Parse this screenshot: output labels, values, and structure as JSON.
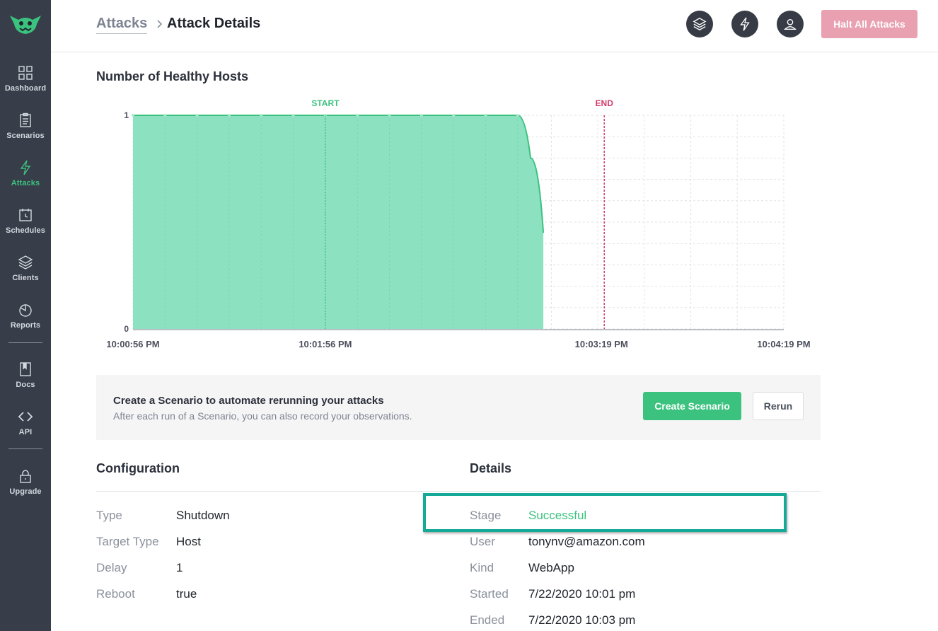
{
  "sidebar": {
    "items": [
      {
        "label": "Dashboard",
        "icon": "dashboard-icon"
      },
      {
        "label": "Scenarios",
        "icon": "clipboard-icon"
      },
      {
        "label": "Attacks",
        "icon": "lightning-icon",
        "active": true
      },
      {
        "label": "Schedules",
        "icon": "calendar-clock-icon"
      },
      {
        "label": "Clients",
        "icon": "layers-icon"
      },
      {
        "label": "Reports",
        "icon": "pie-chart-icon"
      },
      {
        "label": "Docs",
        "icon": "book-icon"
      },
      {
        "label": "API",
        "icon": "code-icon"
      },
      {
        "label": "Upgrade",
        "icon": "lock-icon"
      }
    ]
  },
  "header": {
    "breadcrumb_link": "Attacks",
    "breadcrumb_current": "Attack Details",
    "halt_label": "Halt All Attacks"
  },
  "chart": {
    "title": "Number of Healthy Hosts",
    "start_label": "START",
    "end_label": "END"
  },
  "chart_data": {
    "type": "area",
    "title": "Number of Healthy Hosts",
    "x_tick_labels": [
      "10:00:56 PM",
      "10:01:56 PM",
      "10:03:19 PM",
      "10:04:19 PM"
    ],
    "y_tick_labels": [
      "1",
      "0"
    ],
    "ylim": [
      0,
      1
    ],
    "x_range": [
      "10:00:56 PM",
      "10:04:19 PM"
    ],
    "series": [
      {
        "x": [
          "10:00:56 PM",
          "10:01:06 PM",
          "10:01:16 PM",
          "10:01:26 PM",
          "10:01:36 PM",
          "10:01:46 PM",
          "10:01:56 PM",
          "10:02:06 PM",
          "10:02:16 PM",
          "10:02:26 PM",
          "10:02:36 PM",
          "10:02:46 PM",
          "10:02:56 PM",
          "10:03:00 PM",
          "10:03:04 PM"
        ],
        "values": [
          1,
          1,
          1,
          1,
          1,
          1,
          1,
          1,
          1,
          1,
          1,
          1,
          1,
          0.8,
          0.45
        ]
      }
    ],
    "annotations": [
      {
        "label": "START",
        "x": "10:01:56 PM"
      },
      {
        "label": "END",
        "x": "10:03:23 PM"
      }
    ],
    "grid": true,
    "colors": {
      "fill": "#8ce1c0",
      "line": "#3cc27f",
      "start": "#3cc27f",
      "end": "#d33c6a"
    }
  },
  "banner": {
    "title": "Create a Scenario to automate rerunning your attacks",
    "subtitle": "After each run of a Scenario, you can also record your observations.",
    "create_label": "Create Scenario",
    "rerun_label": "Rerun"
  },
  "configuration": {
    "title": "Configuration",
    "rows": [
      {
        "key": "Type",
        "value": "Shutdown"
      },
      {
        "key": "Target Type",
        "value": "Host"
      },
      {
        "key": "Delay",
        "value": "1"
      },
      {
        "key": "Reboot",
        "value": "true"
      }
    ]
  },
  "details": {
    "title": "Details",
    "rows": [
      {
        "key": "Stage",
        "value": "Successful"
      },
      {
        "key": "User",
        "value": "tonynv@amazon.com"
      },
      {
        "key": "Kind",
        "value": "WebApp"
      },
      {
        "key": "Started",
        "value": "7/22/2020 10:01 pm"
      },
      {
        "key": "Ended",
        "value": "7/22/2020 10:03 pm"
      }
    ]
  },
  "colors": {
    "sidebar": "#373d49",
    "accent": "#3cc27f",
    "halt": "#e9a1b1",
    "highlight": "#15aa97"
  }
}
